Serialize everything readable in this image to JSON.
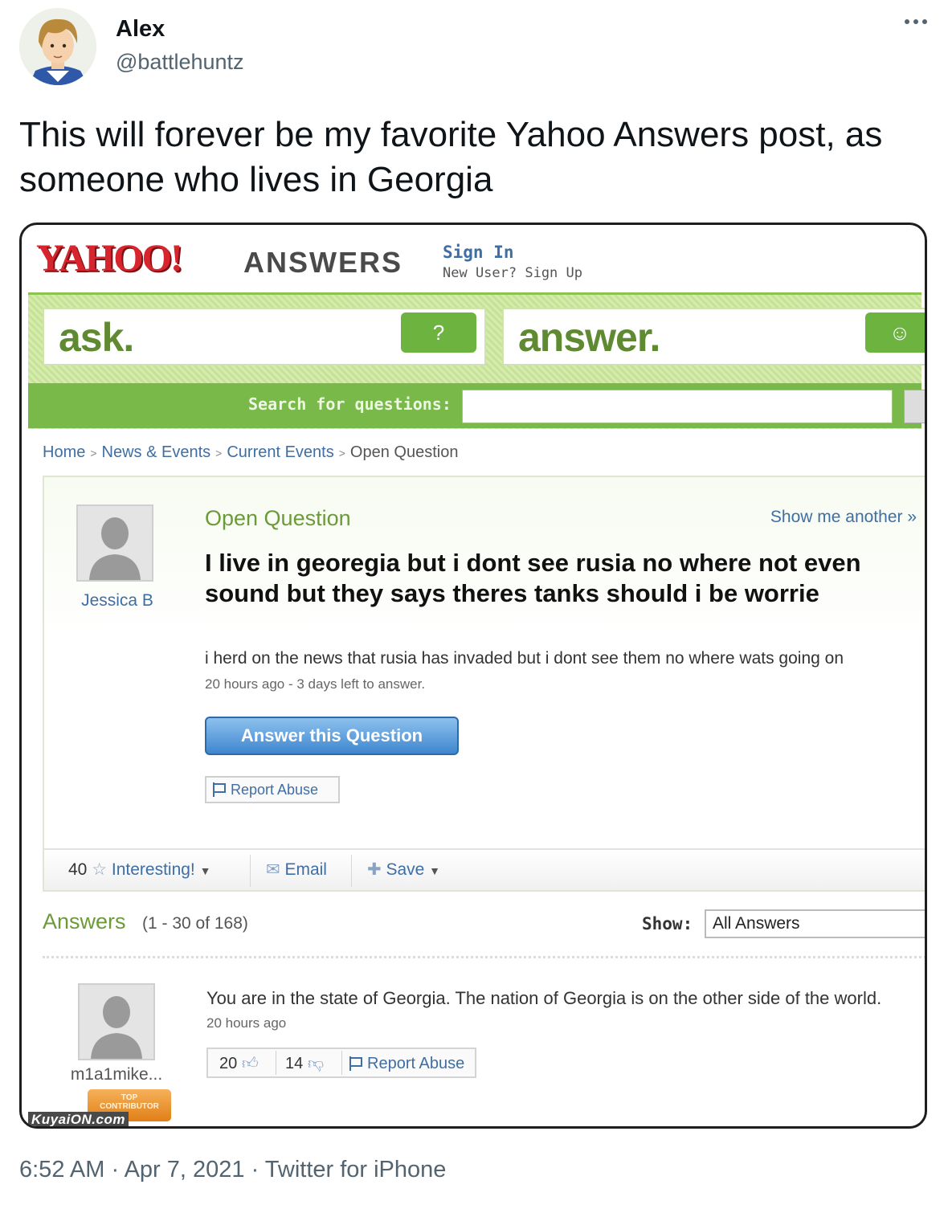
{
  "tweet": {
    "display_name": "Alex",
    "handle": "@battlehuntz",
    "text": "This will forever be my favorite Yahoo Answers post, as someone who lives in Georgia",
    "timestamp": "6:52 AM · Apr 7, 2021 · Twitter for iPhone"
  },
  "yahoo": {
    "logo": "YAHOO!",
    "product": "ANSWERS",
    "sign_in": "Sign In",
    "sign_up": "New User? Sign Up",
    "ask_word": "ask.",
    "answer_word": "answer.",
    "search_label": "Search for questions:",
    "breadcrumb": [
      "Home",
      "News & Events",
      "Current Events",
      "Open Question"
    ],
    "question": {
      "status": "Open Question",
      "show_another": "Show me another »",
      "asker": "Jessica B",
      "title": "I live in georegia but i dont see rusia no where not even sound but they says theres tanks should i be worrie",
      "details": "i herd on the news that rusia has invaded but i dont see them no where wats going on",
      "time": "20 hours ago - 3 days left to answer.",
      "answer_button": "Answer this Question",
      "report_abuse": "Report Abuse",
      "interesting_count": "40",
      "interesting_label": "Interesting!",
      "email_label": "Email",
      "save_label": "Save"
    },
    "answers": {
      "heading": "Answers",
      "range": "(1 - 30 of 168)",
      "show_label": "Show:",
      "show_value": "All Answers",
      "items": [
        {
          "user": "m1a1mike...",
          "badge_line1": "TOP",
          "badge_line2": "CONTRIBUTOR",
          "text": "You are in the state of Georgia. The nation of Georgia is on the other side of the world.",
          "time": "20 hours ago",
          "thumbs_up": "20",
          "thumbs_down": "14",
          "report_abuse": "Report Abuse"
        }
      ]
    },
    "watermark": "KuyaiON.com"
  },
  "colors": {
    "yahoo_red": "#d8252d",
    "yahoo_green": "#78b94a",
    "link_blue": "#3e6ea4",
    "label_green": "#6b9b38"
  }
}
